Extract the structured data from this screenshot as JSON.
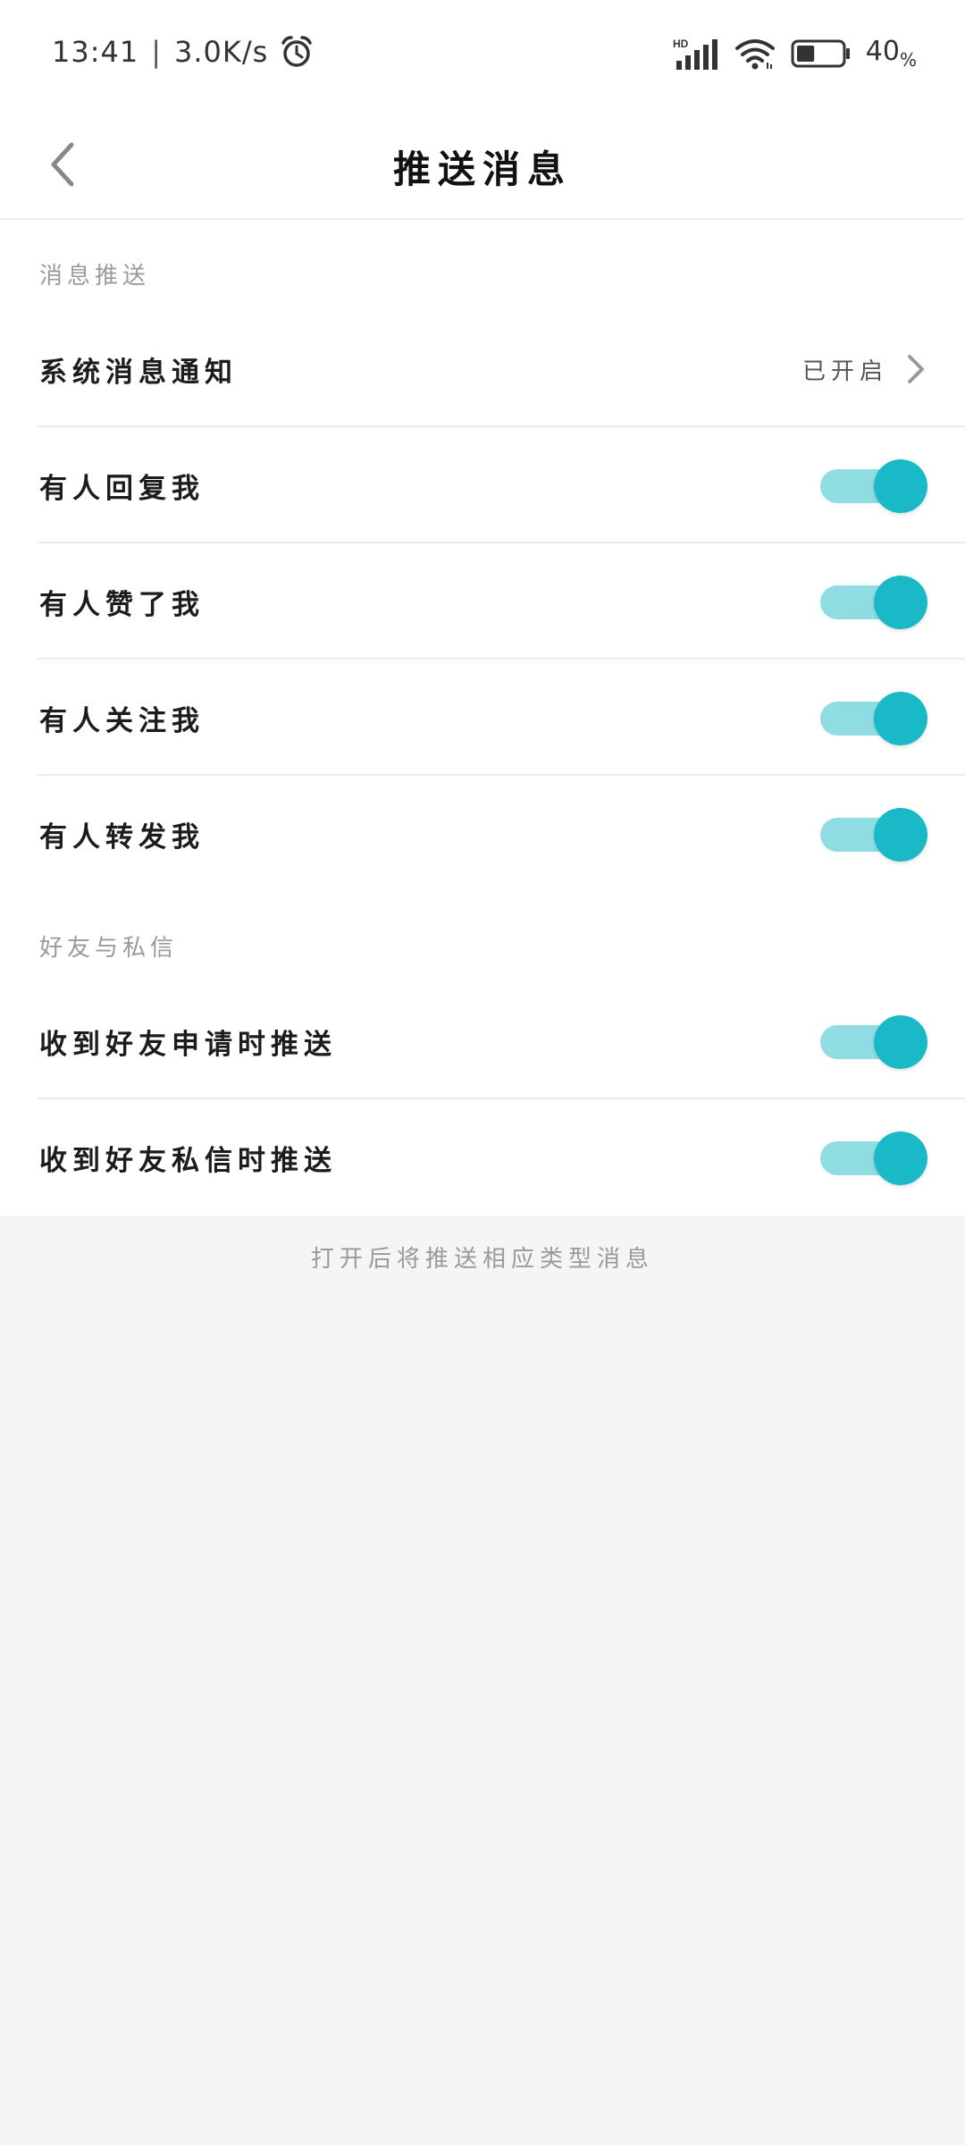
{
  "status_bar": {
    "time": "13:41",
    "separator": "|",
    "net_speed": "3.0K/s",
    "alarm_icon": "alarm-clock-icon",
    "network_label": "HD",
    "signal_icon": "signal-bars-icon",
    "wifi_icon": "wifi-icon",
    "battery_icon": "battery-icon",
    "battery_percent": "40",
    "battery_unit": "%",
    "battery_level": 0.4
  },
  "nav": {
    "back_icon": "chevron-left-icon",
    "title": "推送消息"
  },
  "sections": [
    {
      "header": "消息推送",
      "rows": [
        {
          "label": "系统消息通知",
          "value": "已开启",
          "type": "link"
        },
        {
          "label": "有人回复我",
          "type": "toggle",
          "on": true
        },
        {
          "label": "有人赞了我",
          "type": "toggle",
          "on": true
        },
        {
          "label": "有人关注我",
          "type": "toggle",
          "on": true
        },
        {
          "label": "有人转发我",
          "type": "toggle",
          "on": true
        }
      ]
    },
    {
      "header": "好友与私信",
      "rows": [
        {
          "label": "收到好友申请时推送",
          "type": "toggle",
          "on": true
        },
        {
          "label": "收到好友私信时推送",
          "type": "toggle",
          "on": true
        }
      ]
    }
  ],
  "footer_note": "打开后将推送相应类型消息",
  "colors": {
    "toggle_track_on": "#8fdce3",
    "toggle_knob_on": "#19b9c8",
    "page_background": "#f4f5f7"
  }
}
